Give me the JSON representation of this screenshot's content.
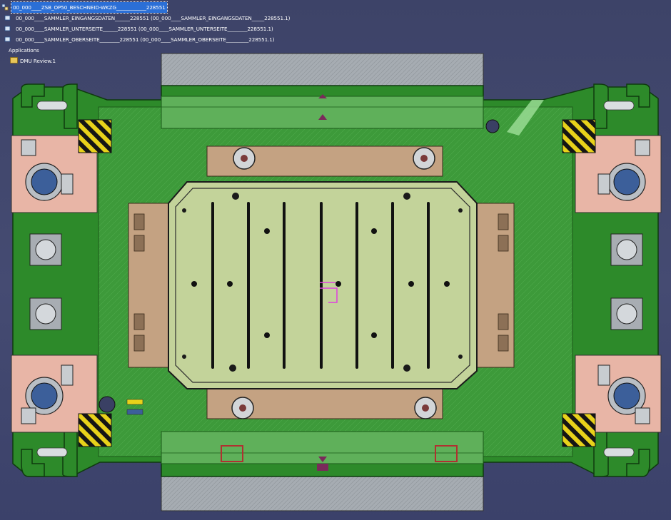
{
  "tree": {
    "root_label": "00_000____ZSB_OP50_BESCHNEID-WKZG____________228551",
    "items": [
      {
        "label": "00_000____SAMMLER_EINGANGSDATEN______228551 (00_000____SAMMLER_EINGANGSDATEN_____228551.1)"
      },
      {
        "label": "00_000____SAMMLER_UNTERSEITE______228551 (00_000____SAMMLER_UNTERSEITE________228551.1)"
      },
      {
        "label": "00_000____SAMMLER_OBERSEITE________228551 (00_000____SAMMLER_OBERSEITE_________228551.1)"
      }
    ],
    "applications_label": "Applications",
    "dmu_label": "DMU Review.1"
  },
  "colors": {
    "background": "#41476e",
    "die_green": "#2d8a2a",
    "die_green_dark": "#1a5a18",
    "pink_block": "#e8b5a6",
    "center_plate": "#c3d39a",
    "tan_rail": "#c4a282",
    "grey_plate": "#9aa0a5",
    "hazard_yellow": "#e8d21a"
  },
  "icons": [
    "assembly-icon",
    "product-icon",
    "folder-icon",
    "hazard-stripe-icon",
    "bolt-hole-icon",
    "hook-icon"
  ]
}
